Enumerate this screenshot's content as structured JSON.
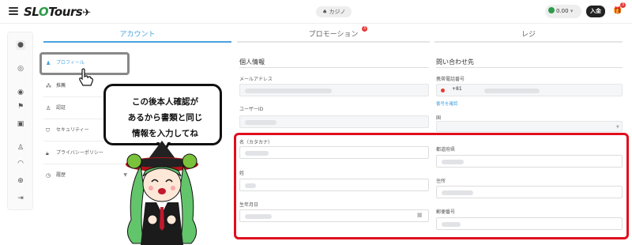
{
  "header": {
    "logo_text": "SL",
    "logo_text2": "Tours",
    "casino_label": "カジノ",
    "balance": "0.00",
    "deposit_label": "入金",
    "gift_count": "3"
  },
  "tabs": [
    {
      "label": "アカウント",
      "active": true
    },
    {
      "label": "プロモーション",
      "badge": "3"
    },
    {
      "label": "レジ"
    }
  ],
  "menu": [
    {
      "label": "プロフィール",
      "icon": "user-icon"
    },
    {
      "label": "推薦",
      "icon": "group-icon"
    },
    {
      "label": "認証",
      "icon": "person-check-icon"
    },
    {
      "label": "セキュリティー",
      "icon": "shield-icon"
    },
    {
      "label": "プライバシーポリシー",
      "icon": "lock-icon"
    },
    {
      "label": "履歴",
      "icon": "clock-icon"
    }
  ],
  "personal": {
    "title": "個人情報",
    "email_label": "メールアドレス",
    "userid_label": "ユーザーID",
    "name_kana_label": "名（カタカナ）",
    "last_name_label": "姓",
    "birthdate_label": "生年月日"
  },
  "contact": {
    "title": "問い合わせ先",
    "phone_label": "携帯電話番号",
    "phone_code": "+81",
    "phone_confirm_link": "番号を確認",
    "country_label": "国",
    "prefecture_label": "都道府県",
    "address_label": "住所",
    "postal_label": "郵便番号"
  },
  "bubble": {
    "line1": "この後本人確認が",
    "line2": "あるから書類と同じ",
    "line3": "情報を入力してね"
  },
  "colors": {
    "accent": "#4aa3df",
    "highlight_red": "#e00e1e",
    "badge_red": "#e53935"
  }
}
